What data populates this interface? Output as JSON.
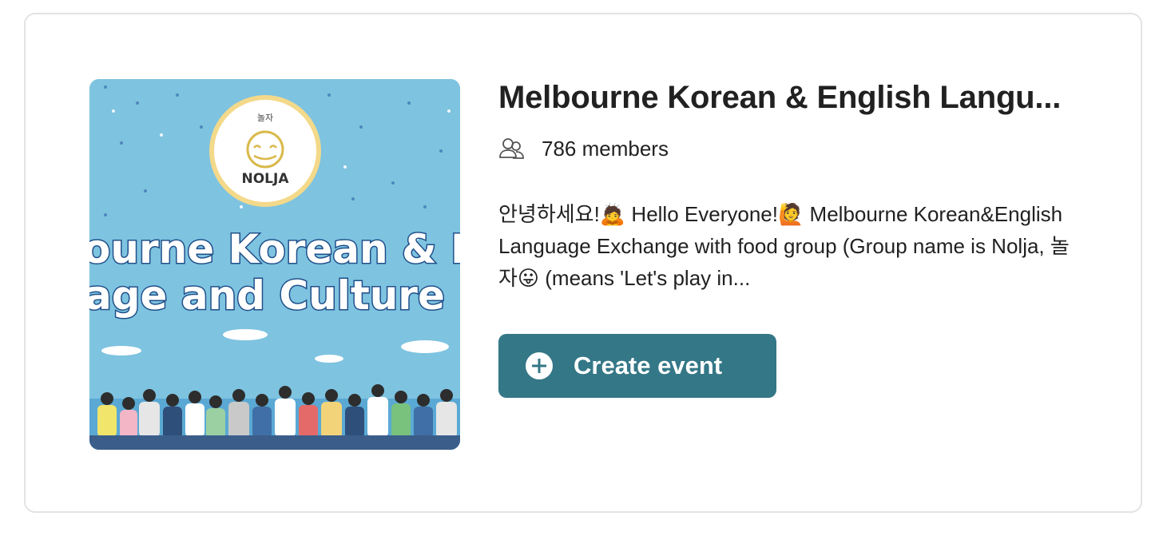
{
  "group": {
    "image_logo_text": "NOLJA",
    "image_logo_hangul": "놀자",
    "image_banner_line1": "ourne Korean & En",
    "image_banner_line2": "age and Culture Exc",
    "title": "Melbourne Korean & English Langu...",
    "members_icon": "people-icon",
    "members_text": "786 members",
    "description": "안녕하세요!🙇 Hello Everyone!🙋 Melbourne Korean&English Language Exchange with food group (Group name is Nolja, 놀자😛 (means 'Let's play in...",
    "action": {
      "icon": "plus-circle-icon",
      "label": "Create event"
    }
  },
  "colors": {
    "button_bg": "#347787",
    "image_sky": "#7ec3e0",
    "border": "#e3e3e3"
  }
}
